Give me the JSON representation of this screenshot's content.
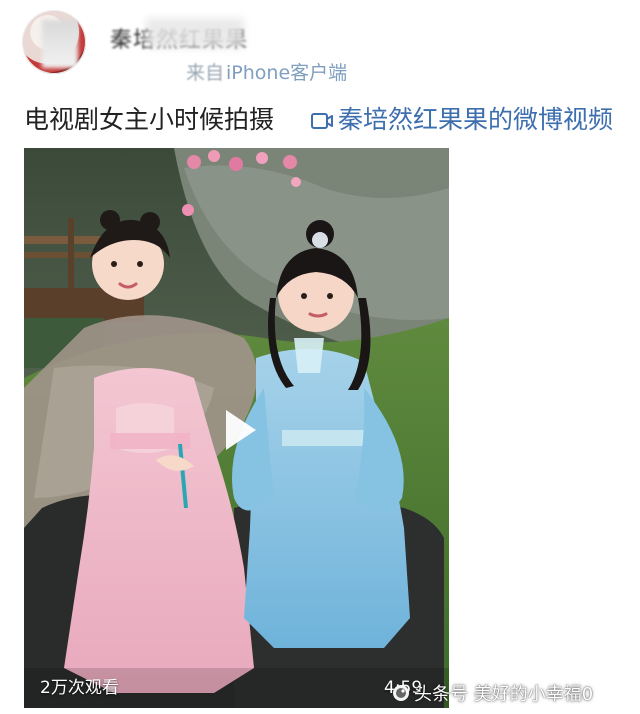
{
  "header": {
    "username": "秦培然红果果",
    "source_prefix": "来自",
    "source_client": "iPhone客户端"
  },
  "post": {
    "text": "电视剧女主小时候拍摄",
    "video_link_label": "秦培然红果果的微博视频"
  },
  "video": {
    "views": "2万次观看",
    "duration": "4:59"
  },
  "watermark": {
    "text": "头条号 美好的小幸福0"
  },
  "icons": {
    "video_link": "video-link-icon",
    "play": "play-icon",
    "watermark": "toutiao-logo-icon"
  },
  "colors": {
    "link": "#3d6fae",
    "client": "#7f9fbf"
  }
}
